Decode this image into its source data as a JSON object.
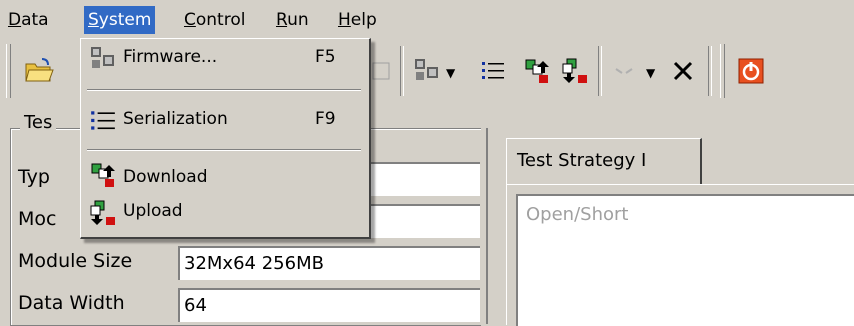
{
  "menubar": {
    "items": [
      {
        "label": "Data",
        "accel": "D",
        "rest": "ata"
      },
      {
        "label": "System",
        "accel": "S",
        "rest": "ystem"
      },
      {
        "label": "Control",
        "accel": "C",
        "rest": "ontrol"
      },
      {
        "label": "Run",
        "accel": "R",
        "rest": "un"
      },
      {
        "label": "Help",
        "accel": "H",
        "rest": "elp"
      }
    ]
  },
  "system_menu": {
    "items": [
      {
        "label": "Firmware...",
        "shortcut": "F5",
        "icon": "firmware-icon"
      },
      {
        "label": "Serialization",
        "shortcut": "F9",
        "icon": "list-icon"
      },
      {
        "label": "Download",
        "shortcut": "",
        "icon": "download-icon"
      },
      {
        "label": "Upload",
        "shortcut": "",
        "icon": "upload-icon"
      }
    ]
  },
  "group": {
    "title_visible": "Tes",
    "fields": [
      {
        "label_visible": "Typ",
        "value": ""
      },
      {
        "label_visible": "Moc",
        "value": ""
      },
      {
        "label": "Module Size",
        "value": "32Mx64 256MB"
      },
      {
        "label": "Data Width",
        "value": "64"
      }
    ]
  },
  "tabs": {
    "active_label": "Test Strategy I"
  },
  "list": {
    "items": [
      "Open/Short"
    ]
  },
  "colors": {
    "face": "#d4d0c8",
    "highlight": "#316ac5",
    "disabled_text": "#a0a0a0"
  }
}
